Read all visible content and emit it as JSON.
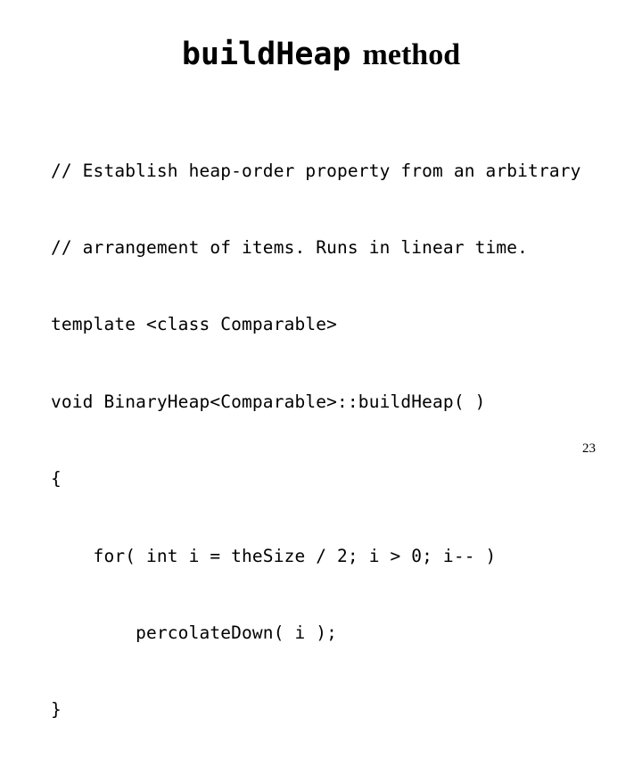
{
  "slide": {
    "background_color": "#ffffff",
    "text_color": "#000000",
    "title": {
      "mono_part": "buildHeap",
      "serif_part": "method",
      "full_text": "buildHeap method"
    },
    "code": {
      "language": "cpp",
      "lines": [
        "// Establish heap-order property from an arbitrary",
        "// arrangement of items. Runs in linear time.",
        "template <class Comparable>",
        "void BinaryHeap<Comparable>::buildHeap( )",
        "{",
        "    for( int i = theSize / 2; i > 0; i-- )",
        "        percolateDown( i );",
        "}"
      ]
    },
    "page_number": "23"
  }
}
